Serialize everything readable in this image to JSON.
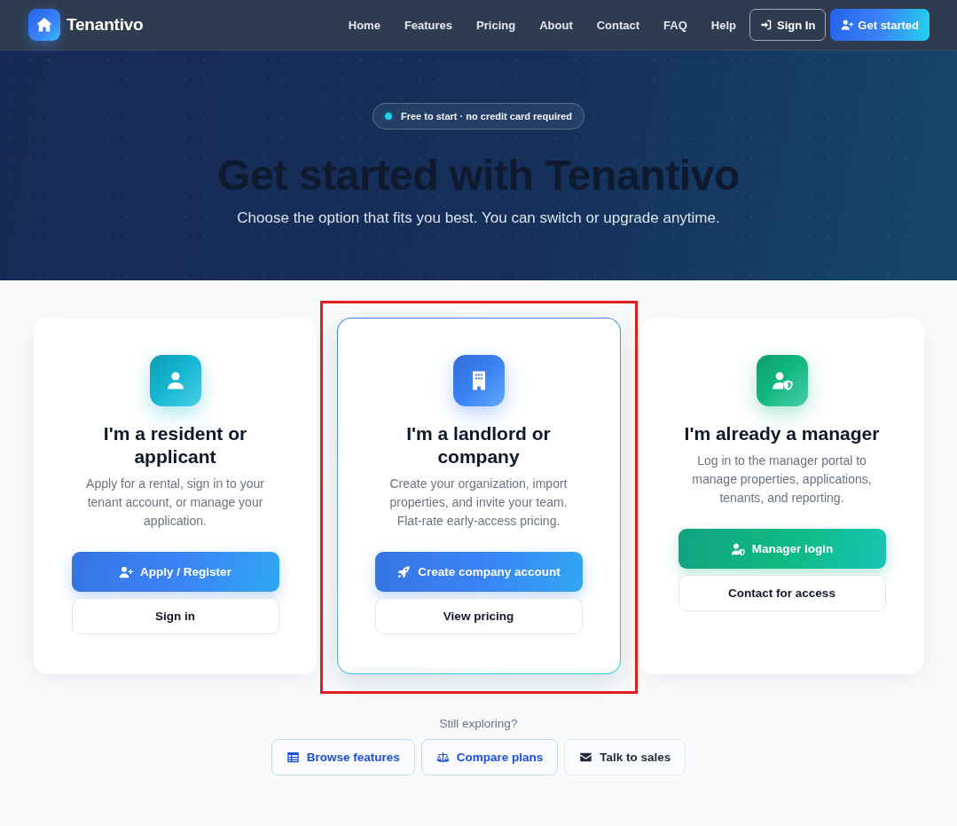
{
  "navbar": {
    "brand": "Tenantivo",
    "links": [
      "Home",
      "Features",
      "Pricing",
      "About",
      "Contact",
      "FAQ",
      "Help"
    ],
    "buttons": [
      {
        "label": "Sign In",
        "kind": "outline"
      },
      {
        "label": "Get started",
        "kind": "primary"
      }
    ]
  },
  "hero": {
    "badge": "Free to start · no credit card required",
    "title": "Get started with Tenantivo",
    "subtitle": "Choose the option that fits you best. You can switch or upgrade anytime."
  },
  "cards": [
    {
      "title": "I'm a resident or applicant",
      "description": "Apply for a rental, sign in to your tenant account, or manage your application.",
      "color": "#14b8d4",
      "featured": false,
      "outlined": false,
      "buttons": [
        {
          "label": "Apply / Register",
          "kind": "primary",
          "color": "#3b82f6"
        },
        {
          "label": "Sign in",
          "kind": "secondary"
        }
      ]
    },
    {
      "title": "I'm a landlord or company",
      "description": "Create your organization, import properties, and invite your team. Flat-rate early-access pricing.",
      "color": "#3b82f6",
      "featured": true,
      "outlined": true,
      "buttons": [
        {
          "label": "Create company account",
          "kind": "primary",
          "color": "#3b82f6"
        },
        {
          "label": "View pricing",
          "kind": "secondary"
        }
      ]
    },
    {
      "title": "I'm already a manager",
      "description": "Log in to the manager portal to manage properties, applications, tenants, and reporting.",
      "color": "#10b981",
      "featured": false,
      "outlined": false,
      "buttons": [
        {
          "label": "Manager login",
          "kind": "primary",
          "color": "#10b981"
        },
        {
          "label": "Contact for access",
          "kind": "secondary"
        }
      ]
    }
  ],
  "explore": {
    "prompt": "Still exploring?",
    "buttons": [
      {
        "label": "Browse features",
        "kind": "accent"
      },
      {
        "label": "Compare plans",
        "kind": "accent"
      },
      {
        "label": "Talk to sales",
        "kind": "plain"
      }
    ]
  }
}
